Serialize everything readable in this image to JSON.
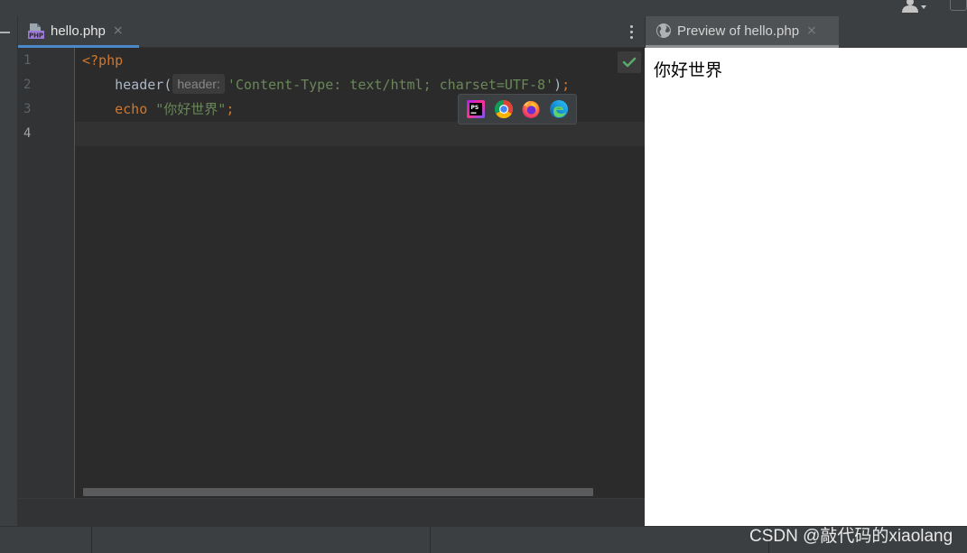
{
  "editor": {
    "tab": {
      "label": "hello.php",
      "icon": "php-file-icon",
      "close": "×"
    },
    "line_numbers": [
      "1",
      "2",
      "3",
      "4"
    ],
    "current_line": 4,
    "code": {
      "line1": {
        "open_tag": "<?php"
      },
      "line2": {
        "func": "header",
        "open_paren": "(",
        "param_hint": "header:",
        "string": "'Content-Type: text/html; charset=UTF-8'",
        "close": ")",
        "semicolon": ";"
      },
      "line3": {
        "keyword": "echo",
        "string": "\"你好世界\"",
        "semicolon": ";"
      }
    },
    "inspection_status": "check-icon",
    "browser_popup": [
      "phpstorm-icon",
      "chrome-icon",
      "firefox-icon",
      "edge-icon"
    ]
  },
  "preview": {
    "tab": {
      "label": "Preview of hello.php",
      "icon": "globe-icon",
      "close": "×"
    },
    "content_text": "你好世界"
  },
  "watermark": "CSDN @敲代码的xiaolang",
  "colors": {
    "keyword": "#cc7832",
    "string": "#6a8759",
    "text": "#a9b7c6",
    "tab_underline": "#4a88c7",
    "editor_bg": "#2b2b2b"
  }
}
